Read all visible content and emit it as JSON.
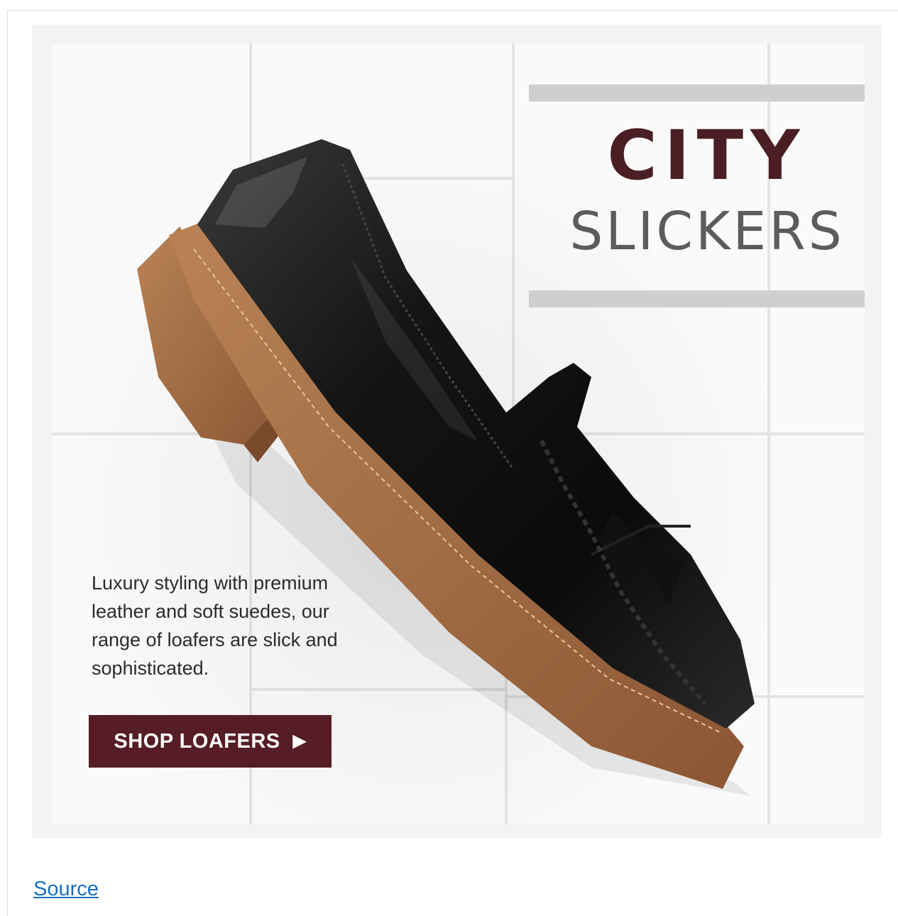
{
  "banner": {
    "headline_line1": "CITY",
    "headline_line2": "SLICKERS",
    "description": "Luxury styling with premium leather and soft suedes, our range of loafers are slick and sophisticated.",
    "cta_label": "SHOP LOAFERS",
    "cta_arrow": "▶",
    "image_subject": "loafer-shoe-image"
  },
  "footer": {
    "source_link_label": "Source"
  },
  "colors": {
    "brand_maroon": "#561d26",
    "headline_dark": "#4a1e24",
    "link_blue": "#1a6fbf"
  }
}
